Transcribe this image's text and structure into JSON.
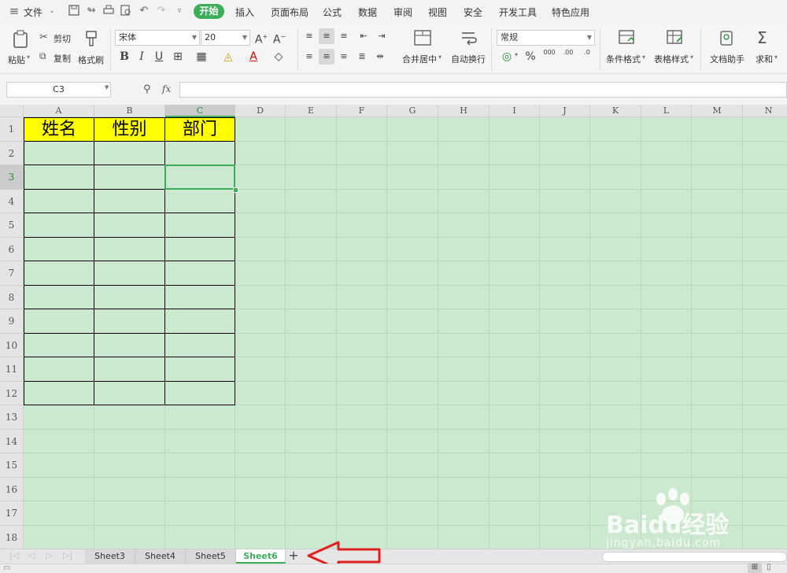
{
  "menubar": {
    "file_label": "文件",
    "tabs": [
      "开始",
      "插入",
      "页面布局",
      "公式",
      "数据",
      "审阅",
      "视图",
      "安全",
      "开发工具",
      "特色应用"
    ],
    "active_tab": "开始"
  },
  "ribbon": {
    "paste_label": "粘贴",
    "cut_label": "剪切",
    "copy_label": "复制",
    "format_painter_label": "格式刷",
    "font_name": "宋体",
    "font_size": "20",
    "merge_center_label": "合并居中",
    "auto_wrap_label": "自动换行",
    "number_format": "常规",
    "percent_symbol": "%",
    "conditional_format_label": "条件格式",
    "table_style_label": "表格样式",
    "doc_assistant_label": "文档助手",
    "sum_label": "求和"
  },
  "formula_bar": {
    "cell_ref": "C3",
    "fx_label": "fx",
    "value": ""
  },
  "grid": {
    "columns": [
      "A",
      "B",
      "C",
      "D",
      "E",
      "F",
      "G",
      "H",
      "I",
      "J",
      "K",
      "L",
      "M",
      "N"
    ],
    "rows": [
      "1",
      "2",
      "3",
      "4",
      "5",
      "6",
      "7",
      "8",
      "9",
      "10",
      "11",
      "12",
      "13",
      "14",
      "15",
      "16",
      "17",
      "18"
    ],
    "header_values": [
      "姓名",
      "性别",
      "部门"
    ],
    "header_fill": "#ffff00",
    "sheet_background": "#cce8cf",
    "selected_cell": "C3"
  },
  "sheets": {
    "tabs": [
      "Sheet3",
      "Sheet4",
      "Sheet5",
      "Sheet6"
    ],
    "active": "Sheet6",
    "add_symbol": "+"
  },
  "annotation": {
    "arrow_color": "#e02020"
  },
  "watermark": {
    "brand": "Baidu经验",
    "url": "jingyan.baidu.com"
  }
}
